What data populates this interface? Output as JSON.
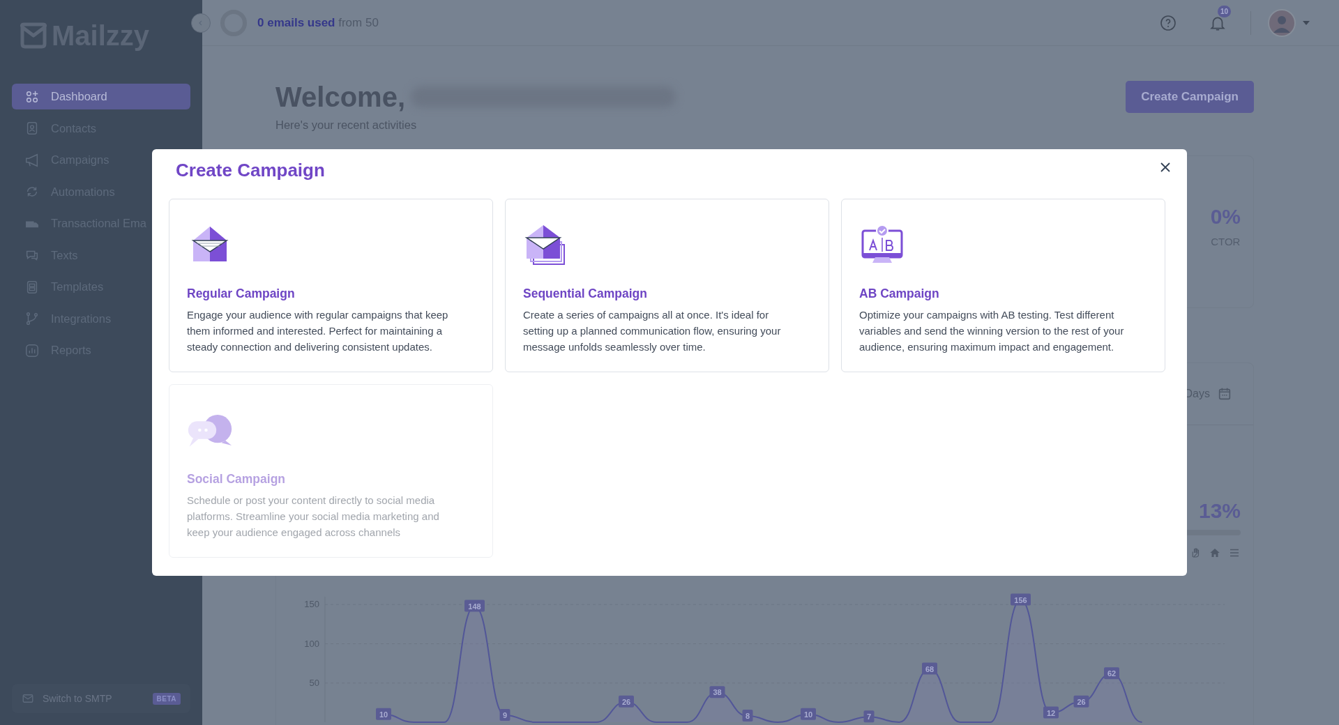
{
  "sidebar": {
    "logo": "Mailzzy",
    "items": [
      {
        "label": "Dashboard",
        "selected": true
      },
      {
        "label": "Contacts",
        "selected": false
      },
      {
        "label": "Campaigns",
        "selected": false
      },
      {
        "label": "Automations",
        "selected": false
      },
      {
        "label": "Transactional Ema",
        "selected": false
      },
      {
        "label": "Texts",
        "selected": false
      },
      {
        "label": "Templates",
        "selected": false
      },
      {
        "label": "Integrations",
        "selected": false
      },
      {
        "label": "Reports",
        "selected": false
      }
    ],
    "switch": {
      "label": "Switch to SMTP",
      "badge": "BETA"
    }
  },
  "topbar": {
    "usage": "**0 emails used** from 50",
    "notifications": "10"
  },
  "welcome": {
    "title": "Welcome,",
    "subtitle": "Here's your recent activities",
    "button": "Create Campaign"
  },
  "stats": {
    "value": "0%",
    "label": "CTOR"
  },
  "activity": {
    "range": "Days",
    "stat": "13%",
    "chart_data": {
      "type": "area",
      "grid": true,
      "ylim": [
        0,
        160
      ],
      "yticks": [
        50,
        100,
        150
      ],
      "values": [
        10,
        0,
        0,
        148,
        9,
        0,
        0,
        0,
        26,
        0,
        0,
        38,
        8,
        0,
        10,
        0,
        7,
        0,
        68,
        0,
        0,
        156,
        12,
        26,
        62,
        0
      ],
      "value_labels": [
        "10",
        null,
        null,
        "148",
        "9",
        null,
        null,
        null,
        "26",
        null,
        null,
        "38",
        "8",
        null,
        "10",
        null,
        "7",
        null,
        "68",
        null,
        null,
        "156",
        "12",
        "26",
        "62",
        null
      ]
    }
  },
  "modal": {
    "title": "Create Campaign",
    "cards": [
      {
        "title": "Regular Campaign",
        "description": "Engage your audience with regular campaigns that keep them informed and interested. Perfect for maintaining a steady connection and delivering consistent updates.",
        "disabled": false
      },
      {
        "title": "Sequential Campaign",
        "description": "Create a series of campaigns all at once. It's ideal for setting up a planned communication flow, ensuring your message unfolds seamlessly over time.",
        "disabled": false
      },
      {
        "title": "AB Campaign",
        "description": "Optimize your campaigns with AB testing. Test different variables and send the winning version to the rest of your audience, ensuring maximum impact and engagement.",
        "disabled": false
      },
      {
        "title": "Social Campaign",
        "description": "Schedule or post your content directly to social media platforms. Streamline your social media marketing and keep your audience engaged across channels",
        "disabled": true
      }
    ]
  }
}
